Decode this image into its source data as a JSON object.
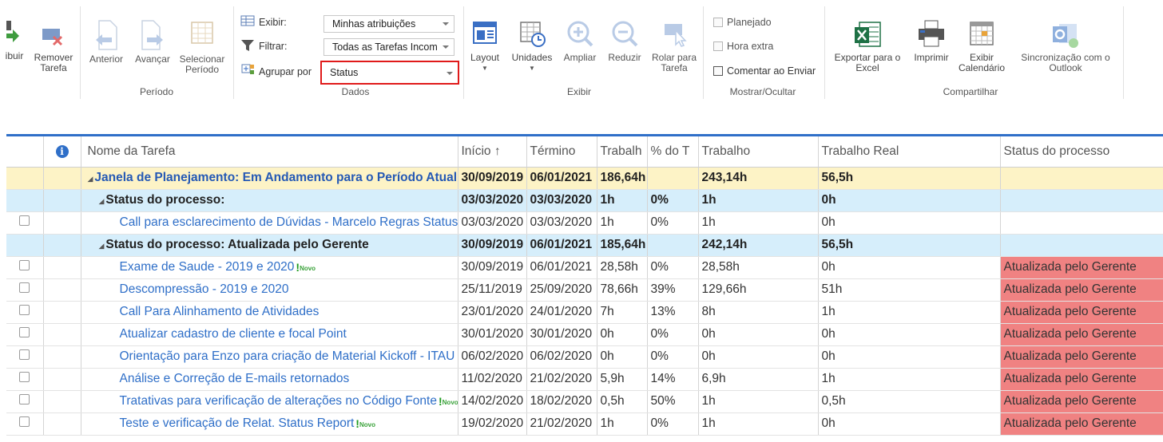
{
  "ribbon": {
    "task_group": {
      "atribuir": "ibuir",
      "remover": "Remover\nTarefa"
    },
    "period": {
      "anterior": "Anterior",
      "avancar": "Avançar",
      "selecionar": "Selecionar\nPeríodo",
      "label": "Período"
    },
    "dados": {
      "exibir_label": "Exibir:",
      "filtrar_label": "Filtrar:",
      "agrupar_label": "Agrupar por",
      "exibir_value": "Minhas atribuições",
      "filtrar_value": "Todas as Tarefas Incom",
      "agrupar_value": "Status",
      "label": "Dados"
    },
    "exibir": {
      "layout": "Layout",
      "unidades": "Unidades",
      "ampliar": "Ampliar",
      "reduzir": "Reduzir",
      "rolar": "Rolar para\nTarefa",
      "label": "Exibir"
    },
    "mostrar": {
      "planejado": "Planejado",
      "hora_extra": "Hora extra",
      "comentar": "Comentar ao Enviar",
      "label": "Mostrar/Ocultar"
    },
    "compartilhar": {
      "exportar": "Exportar para o\nExcel",
      "imprimir": "Imprimir",
      "calendario": "Exibir\nCalendário",
      "sincronizar": "Sincronização com o\nOutlook",
      "label": "Compartilhar"
    }
  },
  "grid": {
    "columns": [
      "",
      "",
      "Nome da Tarefa",
      "Início ↑",
      "Término",
      "Trabalh",
      "% do T",
      "Trabalho",
      "Trabalho Real",
      "Status do processo"
    ],
    "rows": [
      {
        "type": "lvl0",
        "name": "Janela de Planejamento: Em Andamento para o Período Atual",
        "inicio": "30/09/2019",
        "termino": "06/01/2021",
        "trab": "186,64h",
        "pct": "",
        "trabalho": "243,14h",
        "real": "56,5h",
        "status": ""
      },
      {
        "type": "lvl1",
        "name": "Status do processo:",
        "inicio": "03/03/2020",
        "termino": "03/03/2020",
        "trab": "1h",
        "pct": "0%",
        "trabalho": "1h",
        "real": "0h",
        "status": ""
      },
      {
        "type": "task",
        "name": "Call para esclarecimento de Dúvidas - Marcelo Regras Status",
        "inicio": "03/03/2020",
        "termino": "03/03/2020",
        "trab": "1h",
        "pct": "0%",
        "trabalho": "1h",
        "real": "0h",
        "status": "",
        "novo": false
      },
      {
        "type": "lvl1",
        "name": "Status do processo: Atualizada pelo Gerente",
        "inicio": "30/09/2019",
        "termino": "06/01/2021",
        "trab": "185,64h",
        "pct": "",
        "trabalho": "242,14h",
        "real": "56,5h",
        "status": ""
      },
      {
        "type": "task",
        "name": "Exame de Saude - 2019 e 2020",
        "inicio": "30/09/2019",
        "termino": "06/01/2021",
        "trab": "28,58h",
        "pct": "0%",
        "trabalho": "28,58h",
        "real": "0h",
        "status": "Atualizada pelo Gerente",
        "novo": true
      },
      {
        "type": "task",
        "name": "Descompressão - 2019 e 2020",
        "inicio": "25/11/2019",
        "termino": "25/09/2020",
        "trab": "78,66h",
        "pct": "39%",
        "trabalho": "129,66h",
        "real": "51h",
        "status": "Atualizada pelo Gerente",
        "novo": false
      },
      {
        "type": "task",
        "name": "Call Para Alinhamento de Atividades",
        "inicio": "23/01/2020",
        "termino": "24/01/2020",
        "trab": "7h",
        "pct": "13%",
        "trabalho": "8h",
        "real": "1h",
        "status": "Atualizada pelo Gerente",
        "novo": false
      },
      {
        "type": "task",
        "name": "Atualizar cadastro de cliente e focal Point",
        "inicio": "30/01/2020",
        "termino": "30/01/2020",
        "trab": "0h",
        "pct": "0%",
        "trabalho": "0h",
        "real": "0h",
        "status": "Atualizada pelo Gerente",
        "novo": false
      },
      {
        "type": "task",
        "name": "Orientação para Enzo para criação de Material Kickoff - ITAU",
        "inicio": "06/02/2020",
        "termino": "06/02/2020",
        "trab": "0h",
        "pct": "0%",
        "trabalho": "0h",
        "real": "0h",
        "status": "Atualizada pelo Gerente",
        "novo": false
      },
      {
        "type": "task",
        "name": "Análise e Correção de E-mails retornados",
        "inicio": "11/02/2020",
        "termino": "21/02/2020",
        "trab": "5,9h",
        "pct": "14%",
        "trabalho": "6,9h",
        "real": "1h",
        "status": "Atualizada pelo Gerente",
        "novo": false
      },
      {
        "type": "task",
        "name": "Tratativas para verificação de alterações no Código Fonte",
        "inicio": "14/02/2020",
        "termino": "18/02/2020",
        "trab": "0,5h",
        "pct": "50%",
        "trabalho": "1h",
        "real": "0,5h",
        "status": "Atualizada pelo Gerente",
        "novo": true
      },
      {
        "type": "task",
        "name": "Teste e verificação de Relat. Status Report",
        "inicio": "19/02/2020",
        "termino": "21/02/2020",
        "trab": "1h",
        "pct": "0%",
        "trabalho": "1h",
        "real": "0h",
        "status": "Atualizada pelo Gerente",
        "novo": true
      }
    ],
    "novo_label": "Novo"
  },
  "colors": {
    "accent": "#2f6fc8",
    "summary0": "#fdf3c6",
    "summary1": "#d6eefb",
    "status_red": "#f08282",
    "highlight_box": "#e01a1a"
  }
}
